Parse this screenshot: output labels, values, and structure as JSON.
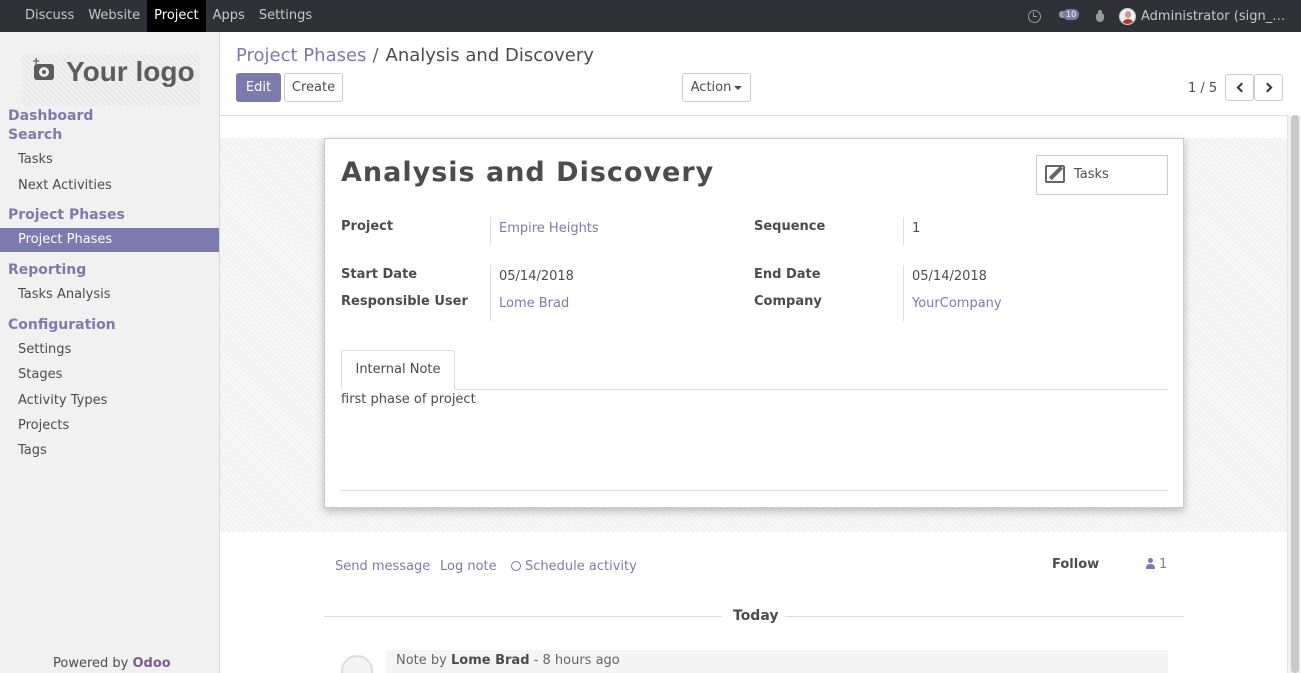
{
  "topbar": {
    "menu": [
      "Discuss",
      "Website",
      "Project",
      "Apps",
      "Settings"
    ],
    "active_menu": "Project",
    "message_count": "10",
    "user": "Administrator (sign_c…"
  },
  "sidebar": {
    "logo_text": "Your logo",
    "sections": [
      {
        "heading": "Dashboard"
      },
      {
        "heading": "Search",
        "items": [
          "Tasks",
          "Next Activities"
        ]
      },
      {
        "heading": "Project Phases",
        "items": [
          "Project Phases"
        ]
      },
      {
        "heading": "Reporting",
        "items": [
          "Tasks Analysis"
        ]
      },
      {
        "heading": "Configuration",
        "items": [
          "Settings",
          "Stages",
          "Activity Types",
          "Projects",
          "Tags"
        ]
      }
    ],
    "active_item": "Project Phases",
    "powered_by": "Powered by",
    "powered_brand": "Odoo"
  },
  "control_panel": {
    "breadcrumb_parent": "Project Phases",
    "breadcrumb_separator": "/",
    "breadcrumb_current": "Analysis and Discovery",
    "edit_label": "Edit",
    "create_label": "Create",
    "action_label": "Action",
    "pager": "1 / 5"
  },
  "record": {
    "title": "Analysis and Discovery",
    "smart_button": "Tasks",
    "fields": {
      "project_label": "Project",
      "project_value": "Empire Heights",
      "sequence_label": "Sequence",
      "sequence_value": "1",
      "start_label": "Start Date",
      "start_value": "05/14/2018",
      "end_label": "End Date",
      "end_value": "05/14/2018",
      "user_label": "Responsible User",
      "user_value": "Lome Brad",
      "company_label": "Company",
      "company_value": "YourCompany"
    },
    "tab_label": "Internal Note",
    "note": "first phase of project"
  },
  "chatter": {
    "send_message": "Send message",
    "log_note": "Log note",
    "schedule_activity": "Schedule activity",
    "follow": "Follow",
    "follower_count": "1",
    "date_separator": "Today",
    "message": {
      "prefix": "Note by",
      "author": "Lome Brad",
      "time": "- 8 hours ago"
    }
  },
  "colors": {
    "accent": "#7c7bad",
    "topbar": "#2f3136"
  }
}
